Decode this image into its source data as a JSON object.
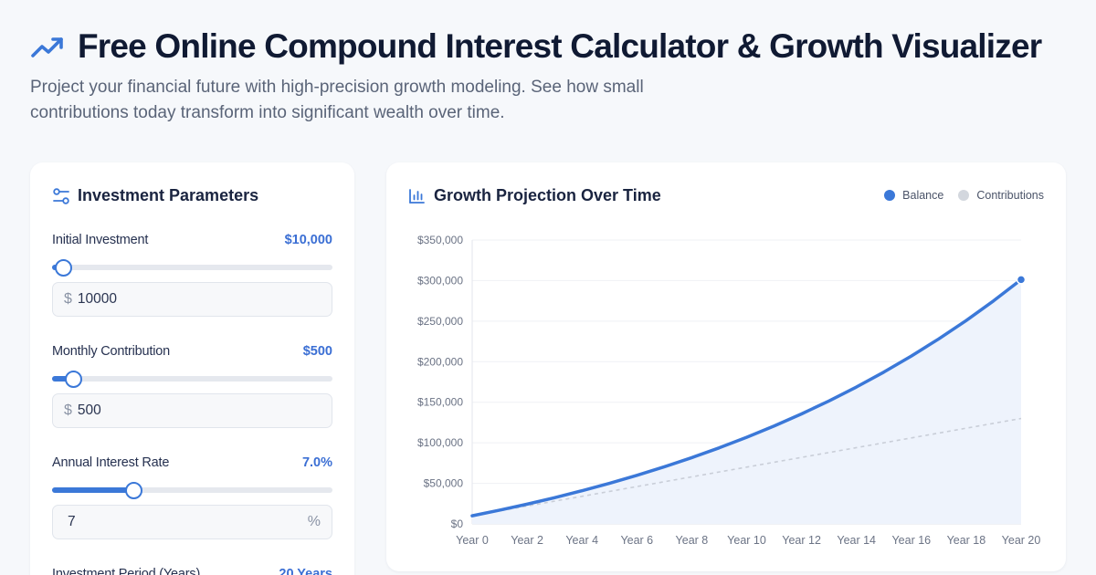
{
  "header": {
    "title": "Free Online Compound Interest Calculator & Growth Visualizer",
    "subtitle": "Project your financial future with high-precision growth modeling. See how small contributions today transform into significant wealth over time."
  },
  "parameters": {
    "title": "Investment Parameters",
    "initial": {
      "label": "Initial Investment",
      "display": "$10,000",
      "prefix": "$",
      "value": "10000",
      "slider_fraction": 0.04
    },
    "monthly": {
      "label": "Monthly Contribution",
      "display": "$500",
      "prefix": "$",
      "value": "500",
      "slider_fraction": 0.075
    },
    "rate": {
      "label": "Annual Interest Rate",
      "display": "7.0%",
      "suffix": "%",
      "value": "7",
      "slider_fraction": 0.29
    },
    "period": {
      "label": "Investment Period (Years)",
      "display": "20 Years"
    }
  },
  "growth": {
    "title": "Growth Projection Over Time",
    "legend": {
      "balance": "Balance",
      "contributions": "Contributions"
    }
  },
  "colors": {
    "accent": "#3b78d8",
    "contributions": "#c9ced8",
    "area": "#eef3fc"
  },
  "icons": {
    "header": "trending-up-icon",
    "parameters": "sliders-icon",
    "growth": "bar-chart-icon"
  },
  "chart_data": {
    "type": "line",
    "x": [
      "Year 0",
      "Year 1",
      "Year 2",
      "Year 3",
      "Year 4",
      "Year 5",
      "Year 6",
      "Year 7",
      "Year 8",
      "Year 9",
      "Year 10",
      "Year 11",
      "Year 12",
      "Year 13",
      "Year 14",
      "Year 15",
      "Year 16",
      "Year 17",
      "Year 18",
      "Year 19",
      "Year 20"
    ],
    "x_tick_labels": [
      "Year 0",
      "Year 2",
      "Year 4",
      "Year 6",
      "Year 8",
      "Year 10",
      "Year 12",
      "Year 14",
      "Year 16",
      "Year 18",
      "Year 20"
    ],
    "series": [
      {
        "name": "Balance",
        "values": [
          10000,
          16929,
          24359,
          32327,
          40870,
          50030,
          59852,
          70384,
          81676,
          93784,
          106768,
          120690,
          135618,
          151625,
          168789,
          187193,
          206927,
          228087,
          250775,
          275103,
          301188
        ]
      },
      {
        "name": "Contributions",
        "values": [
          10000,
          16000,
          22000,
          28000,
          34000,
          40000,
          46000,
          52000,
          58000,
          64000,
          70000,
          76000,
          82000,
          88000,
          94000,
          100000,
          106000,
          112000,
          118000,
          124000,
          130000
        ]
      }
    ],
    "y_tick_labels": [
      "$0",
      "$50,000",
      "$100,000",
      "$150,000",
      "$200,000",
      "$250,000",
      "$300,000",
      "$350,000"
    ],
    "y_ticks": [
      0,
      50000,
      100000,
      150000,
      200000,
      250000,
      300000,
      350000
    ],
    "ylim": [
      0,
      350000
    ],
    "grid": true,
    "legend_position": "top-right"
  }
}
